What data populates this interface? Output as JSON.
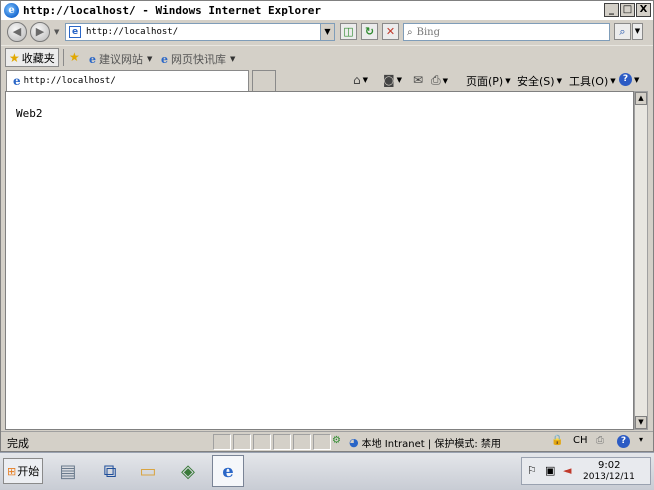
{
  "window": {
    "title": "http://localhost/ - Windows Internet Explorer",
    "controls": {
      "minimize": "_",
      "maximize": "□",
      "close": "X"
    }
  },
  "address_bar": {
    "url": "http://localhost/"
  },
  "search": {
    "placeholder": "Bing"
  },
  "favorites_bar": {
    "favorites_label": "收藏夹",
    "links": [
      {
        "label": "建议网站"
      },
      {
        "label": "网页快讯库"
      }
    ]
  },
  "tab": {
    "title": "http://localhost/"
  },
  "command_bar": {
    "page": "页面(P)",
    "safety": "安全(S)",
    "tools": "工具(O)"
  },
  "page": {
    "content": "Web2"
  },
  "status_bar": {
    "status": "完成",
    "zone": "本地 Intranet | 保护模式: 禁用",
    "language": "CH"
  },
  "taskbar": {
    "start_label": "开始",
    "apps": [
      "server-manager",
      "powershell",
      "explorer",
      "shield",
      "internet-explorer"
    ],
    "time": "9:02",
    "date": "2013/12/11"
  },
  "colors": {
    "accent": "#2a66c7",
    "chrome": "#d4d0c8"
  }
}
